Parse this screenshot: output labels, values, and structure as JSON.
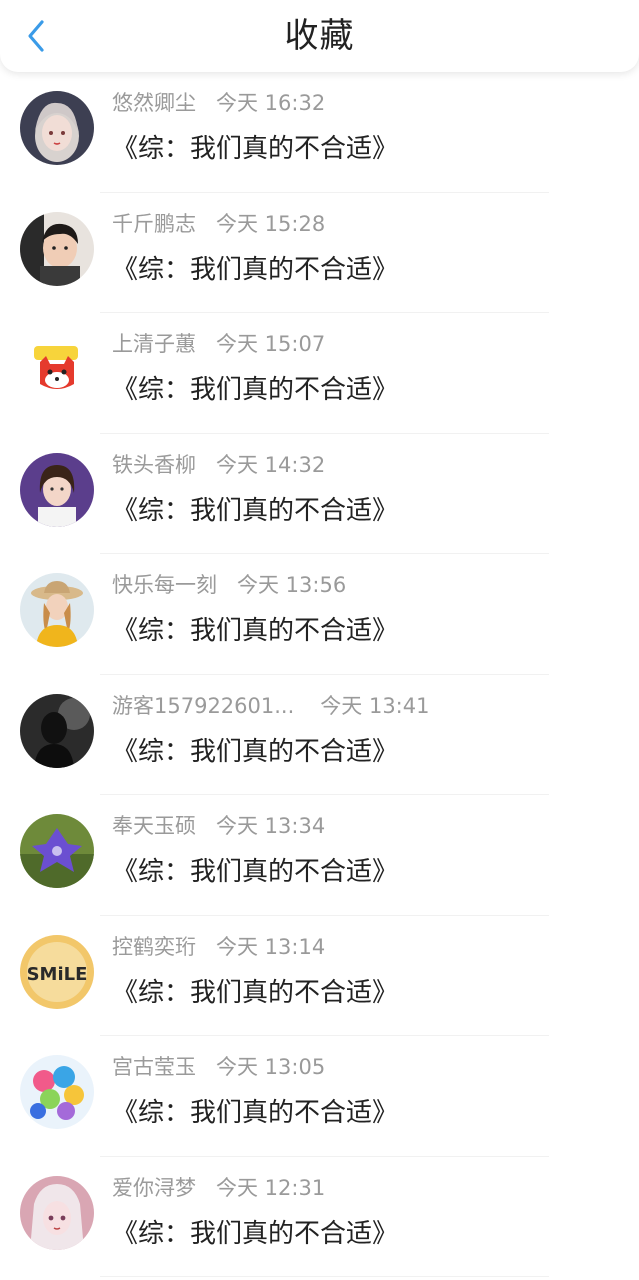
{
  "header": {
    "title": "收藏",
    "back_icon": "chevron-left-icon",
    "accent": "#3a9be8"
  },
  "favorites": [
    {
      "user": "悠然卿尘",
      "time": "今天 16:32",
      "book": "《综：我们真的不合适》",
      "avatar_icon": "anime-girl-avatar"
    },
    {
      "user": "千斤鹏志",
      "time": "今天 15:28",
      "book": "《综：我们真的不合适》",
      "avatar_icon": "child-photo-avatar"
    },
    {
      "user": "上清子蕙",
      "time": "今天 15:07",
      "book": "《综：我们真的不合适》",
      "avatar_icon": "cartoon-fox-avatar"
    },
    {
      "user": "铁头香柳",
      "time": "今天 14:32",
      "book": "《综：我们真的不合适》",
      "avatar_icon": "girl-photo-avatar"
    },
    {
      "user": "快乐每一刻",
      "time": "今天 13:56",
      "book": "《综：我们真的不合适》",
      "avatar_icon": "girl-hat-avatar"
    },
    {
      "user": "游客157922601...",
      "time": "今天 13:41",
      "book": "《综：我们真的不合适》",
      "avatar_icon": "dark-silhouette-avatar"
    },
    {
      "user": "奉天玉硕",
      "time": "今天 13:34",
      "book": "《综：我们真的不合适》",
      "avatar_icon": "purple-flower-avatar"
    },
    {
      "user": "控鹤奕珩",
      "time": "今天 13:14",
      "book": "《综：我们真的不合适》",
      "avatar_icon": "smile-text-avatar"
    },
    {
      "user": "宫古莹玉",
      "time": "今天 13:05",
      "book": "《综：我们真的不合适》",
      "avatar_icon": "balloons-avatar"
    },
    {
      "user": "爱你浔梦",
      "time": "今天 12:31",
      "book": "《综：我们真的不合适》",
      "avatar_icon": "anime-pink-avatar"
    }
  ]
}
